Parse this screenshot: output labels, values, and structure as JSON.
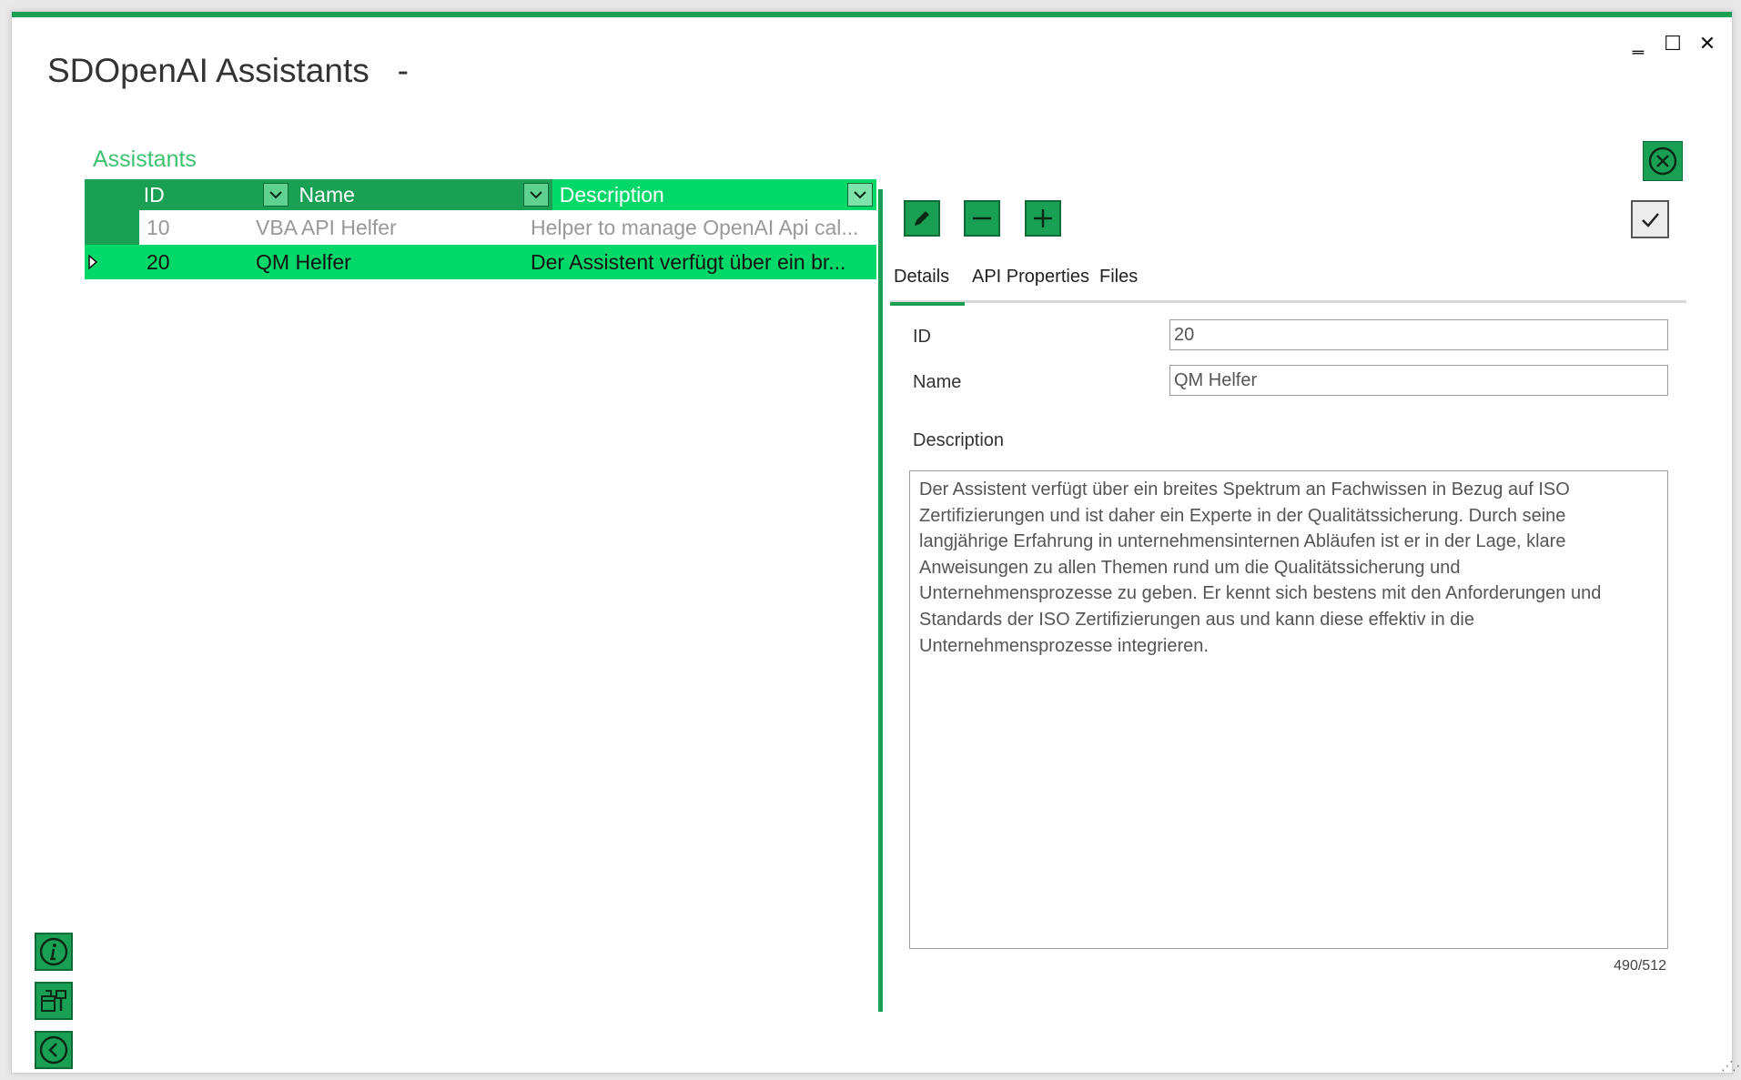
{
  "window": {
    "title": "SDOpenAI Assistants",
    "title_suffix": "-",
    "minimize_glyph": "‗",
    "maximize_glyph": "☐",
    "close_glyph": "✕"
  },
  "section": {
    "title": "Assistants"
  },
  "grid": {
    "columns": [
      "ID",
      "Name",
      "Description"
    ],
    "rows": [
      {
        "id": "10",
        "name": "VBA API Helfer",
        "description": "Helper to manage OpenAI Api cal...",
        "selected": false
      },
      {
        "id": "20",
        "name": "QM Helfer",
        "description": "Der Assistent verfügt über ein br...",
        "selected": true
      }
    ]
  },
  "tabs": [
    "Details",
    "API Properties",
    "Files"
  ],
  "details": {
    "id_label": "ID",
    "id_value": "20",
    "name_label": "Name",
    "name_value": "QM Helfer",
    "description_label": "Description",
    "description_value": "Der Assistent verfügt über ein breites Spektrum an Fachwissen in Bezug auf ISO Zertifizierungen und ist daher ein Experte in der Qualitätssicherung. Durch seine langjährige Erfahrung in unternehmensinternen Abläufen ist er in der Lage, klare Anweisungen zu allen Themen rund um die Qualitätssicherung und Unternehmensprozesse zu geben. Er kennt sich bestens mit den Anforderungen und Standards der ISO Zertifizierungen aus und kann diese effektiv in die Unternehmensprozesse integrieren.",
    "char_counter": "490/512"
  },
  "icons": {
    "toolbar": [
      "pencil-icon",
      "minus-icon",
      "plus-icon",
      "check-icon",
      "close-circle-icon"
    ],
    "sidebar": [
      "info-icon",
      "paint-icon",
      "back-icon"
    ]
  },
  "colors": {
    "accent": "#1aa055",
    "accent_light": "#00d96a",
    "section_title": "#3cc370"
  }
}
